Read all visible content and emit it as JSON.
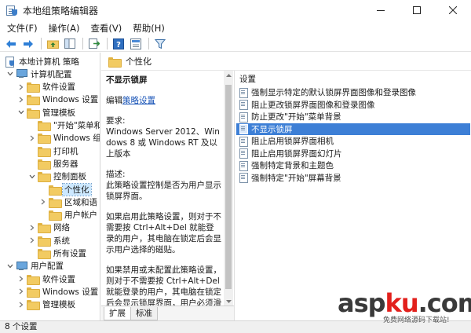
{
  "window": {
    "title": "本地组策略编辑器",
    "controls": [
      "minimize-icon",
      "maximize-icon",
      "close-icon"
    ]
  },
  "menu": [
    "文件(F)",
    "操作(A)",
    "查看(V)",
    "帮助(H)"
  ],
  "toolbar": {
    "buttons": [
      "back-arrow-icon",
      "forward-arrow-icon",
      "folder-up-icon",
      "show-hide-tree-icon",
      "export-list-icon",
      "help-icon",
      "properties-icon",
      "filter-icon"
    ]
  },
  "tree": {
    "items": [
      {
        "label": "本地计算机 策略",
        "level": 0,
        "icon": "policy-root-icon",
        "expander": "none"
      },
      {
        "label": "计算机配置",
        "level": 1,
        "icon": "computer-icon",
        "expander": "open"
      },
      {
        "label": "软件设置",
        "level": 2,
        "icon": "folder-icon",
        "expander": "closed"
      },
      {
        "label": "Windows 设置",
        "level": 2,
        "icon": "folder-icon",
        "expander": "closed"
      },
      {
        "label": "管理模板",
        "level": 2,
        "icon": "folder-icon",
        "expander": "open"
      },
      {
        "label": "\"开始\"菜单和",
        "level": 3,
        "icon": "folder-icon",
        "expander": "none"
      },
      {
        "label": "Windows 组",
        "level": 3,
        "icon": "folder-icon",
        "expander": "closed"
      },
      {
        "label": "打印机",
        "level": 3,
        "icon": "folder-icon",
        "expander": "none"
      },
      {
        "label": "服务器",
        "level": 3,
        "icon": "folder-icon",
        "expander": "none"
      },
      {
        "label": "控制面板",
        "level": 3,
        "icon": "folder-icon",
        "expander": "open"
      },
      {
        "label": "个性化",
        "level": 4,
        "icon": "folder-open-icon",
        "expander": "none",
        "selected": true
      },
      {
        "label": "区域和语",
        "level": 4,
        "icon": "folder-icon",
        "expander": "closed"
      },
      {
        "label": "用户帐户",
        "level": 4,
        "icon": "folder-icon",
        "expander": "none"
      },
      {
        "label": "网络",
        "level": 3,
        "icon": "folder-icon",
        "expander": "closed"
      },
      {
        "label": "系统",
        "level": 3,
        "icon": "folder-icon",
        "expander": "closed"
      },
      {
        "label": "所有设置",
        "level": 3,
        "icon": "folder-icon",
        "expander": "none"
      },
      {
        "label": "用户配置",
        "level": 1,
        "icon": "user-config-icon",
        "expander": "open"
      },
      {
        "label": "软件设置",
        "level": 2,
        "icon": "folder-icon",
        "expander": "closed"
      },
      {
        "label": "Windows 设置",
        "level": 2,
        "icon": "folder-icon",
        "expander": "closed"
      },
      {
        "label": "管理模板",
        "level": 2,
        "icon": "folder-icon",
        "expander": "closed"
      }
    ]
  },
  "pane_header": "个性化",
  "description": {
    "title": "不显示锁屏",
    "edit_prefix": "编辑",
    "edit_link": "策略设置",
    "requirements_label": "要求:",
    "requirements_text": "Windows Server 2012、Windows 8 或 Windows RT 及以上版本",
    "desc_label": "描述:",
    "desc_text": "此策略设置控制是否为用户显示锁屏界面。",
    "para_enabled": "如果启用此策略设置，则对于不需要按 Ctrl+Alt+Del 就能登录的用户，其电脑在锁定后会显示用户选择的磁贴。",
    "para_disabled": "如果禁用或未配置此策略设置，则对于不需要按 Ctrl+Alt+Del 就能登录的用户，其电脑在锁定后会显示锁屏界面，用户必须滑动锁屏"
  },
  "tabs": [
    "扩展",
    "标准"
  ],
  "settings": {
    "header": "设置",
    "items": [
      "强制显示特定的默认锁屏界面图像和登录图像",
      "阻止更改锁屏界面图像和登录图像",
      "防止更改\"开始\"菜单背景",
      "不显示锁屏",
      "阻止启用锁屏界面相机",
      "阻止启用锁屏界面幻灯片",
      "强制特定背景和主题色",
      "强制特定\"开始\"屏幕背景"
    ],
    "selected_index": 3
  },
  "status": "8 个设置",
  "watermark": {
    "logo_a": "asp",
    "logo_b": "ku",
    "logo_c": ".com",
    "sub": "免费网络源码下载站!"
  }
}
